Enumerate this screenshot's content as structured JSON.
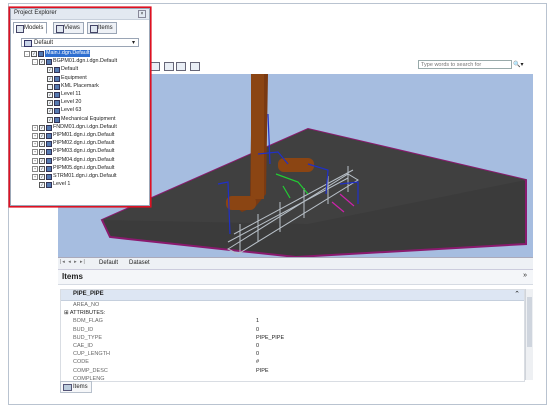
{
  "project_explorer": {
    "title": "Project Explorer",
    "tabs": [
      {
        "label": "Models"
      },
      {
        "label": "Views"
      },
      {
        "label": "Items"
      }
    ],
    "model_dropdown": "Default",
    "tree": [
      {
        "label": "Main.i.dgn.Default",
        "level": 0,
        "expander": "-",
        "checked": true,
        "selected": true
      },
      {
        "label": "BGPM01.dgn.i.dgn.Default",
        "level": 1,
        "expander": "-",
        "checked": true
      },
      {
        "label": "Default",
        "level": 2,
        "checked": true
      },
      {
        "label": "Equipment",
        "level": 2,
        "checked": true
      },
      {
        "label": "KML Placemark",
        "level": 2,
        "checked": false
      },
      {
        "label": "Level 11",
        "level": 2,
        "checked": true
      },
      {
        "label": "Level 20",
        "level": 2,
        "checked": true
      },
      {
        "label": "Level 63",
        "level": 2,
        "checked": true
      },
      {
        "label": "Mechanical Equipment",
        "level": 2,
        "checked": true
      },
      {
        "label": "FNDM01.dgn.i.dgn.Default",
        "level": 1,
        "expander": "+",
        "checked": true
      },
      {
        "label": "PIPM01.dgn.i.dgn.Default",
        "level": 1,
        "expander": "+",
        "checked": true
      },
      {
        "label": "PIPM02.dgn.i.dgn.Default",
        "level": 1,
        "expander": "+",
        "checked": true
      },
      {
        "label": "PIPM03.dgn.i.dgn.Default",
        "level": 1,
        "expander": "+",
        "checked": true
      },
      {
        "label": "PIPM04.dgn.i.dgn.Default",
        "level": 1,
        "expander": "+",
        "checked": true
      },
      {
        "label": "PIPM05.dgn.i.dgn.Default",
        "level": 1,
        "expander": "+",
        "checked": true
      },
      {
        "label": "STRM01.dgn.i.dgn.Default",
        "level": 1,
        "expander": "+",
        "checked": true
      },
      {
        "label": "Level 1",
        "level": 1,
        "checked": true
      }
    ]
  },
  "toolbar": {
    "search_placeholder": "Type words to search for",
    "search_button_icon": "search-dropdown-icon"
  },
  "view_tabs": [
    {
      "label": "Default"
    },
    {
      "label": "Dataset"
    }
  ],
  "items_panel": {
    "title": "Items",
    "group_header": "PIPE_PIPE",
    "properties": [
      {
        "key": "AREA_NO",
        "value": ""
      },
      {
        "key": "ATTRIBUTES:",
        "value": "",
        "is_header": true
      },
      {
        "key": "BOM_FLAG",
        "value": "1"
      },
      {
        "key": "BUD_ID",
        "value": "0"
      },
      {
        "key": "BUD_TYPE",
        "value": "PIPE_PIPE"
      },
      {
        "key": "CAE_ID",
        "value": "0"
      },
      {
        "key": "CUP_LENGTH",
        "value": "0"
      },
      {
        "key": "CODE",
        "value": "#"
      },
      {
        "key": "COMP_DESC",
        "value": "PIPE"
      },
      {
        "key": "COMPLENG",
        "value": ""
      }
    ]
  },
  "bottom_tab": {
    "label": "Items"
  },
  "colors": {
    "highlight_box": "#dd1122",
    "viewport_sky": "#a6bde0",
    "floor": "#3a3a3a",
    "floor_edge": "#8a1a6e",
    "chimney": "#8b4513"
  }
}
